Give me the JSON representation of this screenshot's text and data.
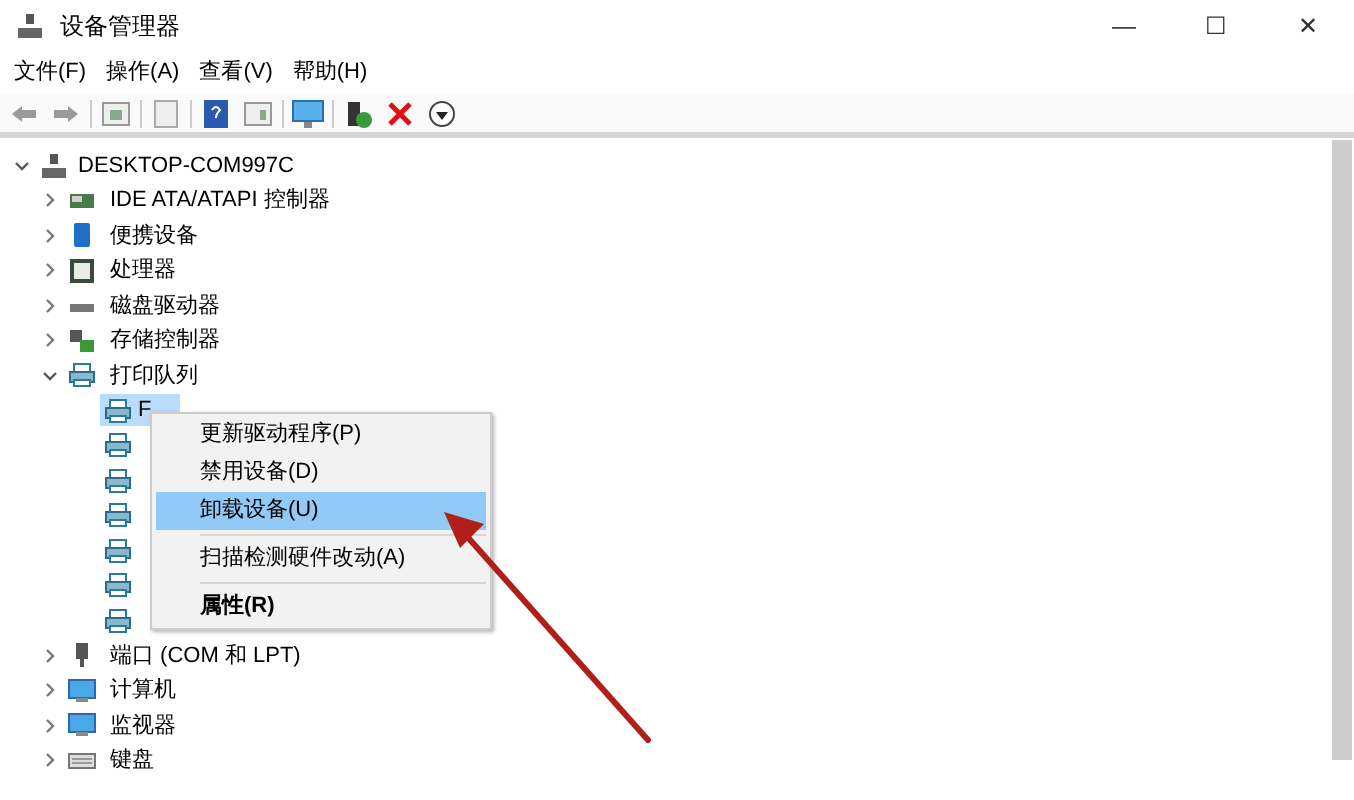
{
  "window": {
    "title": "设备管理器",
    "controls": [
      "—",
      "☐",
      "✕"
    ]
  },
  "menu": [
    "文件(F)",
    "操作(A)",
    "查看(V)",
    "帮助(H)"
  ],
  "tree": {
    "label": "DESKTOP-COM997C",
    "expanded": true,
    "children": [
      {
        "label": "IDE ATA/ATAPI 控制器",
        "kind": "ide",
        "expanded": false
      },
      {
        "label": "便携设备",
        "kind": "portable",
        "expanded": false
      },
      {
        "label": "处理器",
        "kind": "cpu",
        "expanded": false
      },
      {
        "label": "磁盘驱动器",
        "kind": "disk",
        "expanded": false
      },
      {
        "label": "存储控制器",
        "kind": "storage",
        "expanded": false
      },
      {
        "label": "打印队列",
        "kind": "printer",
        "expanded": true,
        "children": [
          {
            "label": "F",
            "kind": "printer",
            "selected": true
          },
          {
            "kind": "printer",
            "selected": false
          },
          {
            "kind": "printer",
            "selected": false
          },
          {
            "kind": "printer",
            "selected": false
          },
          {
            "kind": "printer",
            "selected": false
          },
          {
            "kind": "printer",
            "selected": false
          },
          {
            "kind": "printer",
            "selected": false
          }
        ]
      },
      {
        "label": "端口 (COM 和 LPT)",
        "kind": "port",
        "expanded": false
      },
      {
        "label": "计算机",
        "kind": "monitor",
        "expanded": false
      },
      {
        "label": "监视器",
        "kind": "monitor",
        "expanded": false
      },
      {
        "label": "键盘",
        "kind": "keyboard",
        "expanded": false
      }
    ]
  },
  "context_menu": [
    {
      "kind": "item",
      "label": "更新驱动程序(P)",
      "selected": false
    },
    {
      "kind": "item",
      "label": "禁用设备(D)",
      "selected": false
    },
    {
      "kind": "item",
      "label": "卸载设备(U)",
      "selected": true
    },
    {
      "kind": "separator"
    },
    {
      "kind": "item",
      "label": "扫描检测硬件改动(A)",
      "selected": false
    },
    {
      "kind": "separator"
    },
    {
      "kind": "bold",
      "label": "属性(R)",
      "selected": false
    }
  ]
}
